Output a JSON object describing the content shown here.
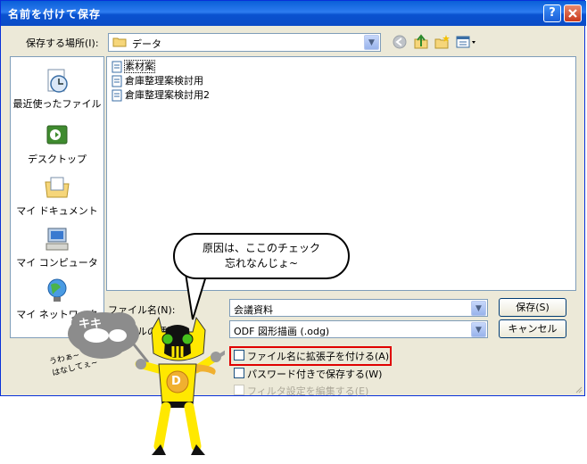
{
  "window": {
    "title": "名前を付けて保存",
    "help_label": "?",
    "close_label": "X"
  },
  "toolbar": {
    "save_in_label": "保存する場所(I):",
    "folder": "データ",
    "icons": [
      "back-icon",
      "up-folder-icon",
      "new-folder-icon",
      "view-menu-icon"
    ]
  },
  "places": [
    {
      "label": "最近使ったファイル",
      "icon": "recent-icon"
    },
    {
      "label": "デスクトップ",
      "icon": "desktop-icon"
    },
    {
      "label": "マイ ドキュメント",
      "icon": "documents-icon"
    },
    {
      "label": "マイ コンピュータ",
      "icon": "computer-icon"
    },
    {
      "label": "マイ ネットワーク",
      "icon": "network-icon"
    }
  ],
  "files": [
    {
      "name": "素材案"
    },
    {
      "name": "倉庫整理案検討用"
    },
    {
      "name": "倉庫整理案検討用2"
    }
  ],
  "form": {
    "filename_label": "ファイル名(N):",
    "filename_value": "会議資料",
    "filetype_label": "ファイルの種類",
    "filetype_value": "ODF 図形描画 (.odg)",
    "save_button": "保存(S)",
    "cancel_button": "キャンセル"
  },
  "options": [
    {
      "label": "ファイル名に拡張子を付ける(A)",
      "checked": false,
      "enabled": true
    },
    {
      "label": "パスワード付きで保存する(W)",
      "checked": false,
      "enabled": true
    },
    {
      "label": "フィルタ設定を編集する(E)",
      "checked": false,
      "enabled": false
    }
  ],
  "illustration": {
    "bubble_line1": "原因は、ここのチェック",
    "bubble_line2": "忘れなんじょ~",
    "cloud_text": "キキ",
    "scream_text": "うわぁ~\nはなしてぇ~",
    "hero_badge": "D"
  },
  "colors": {
    "title_bar": "#0a5fd8",
    "dialog_bg": "#ece9d8",
    "highlight_border": "#e00000",
    "hero_yellow": "#ffe800"
  }
}
